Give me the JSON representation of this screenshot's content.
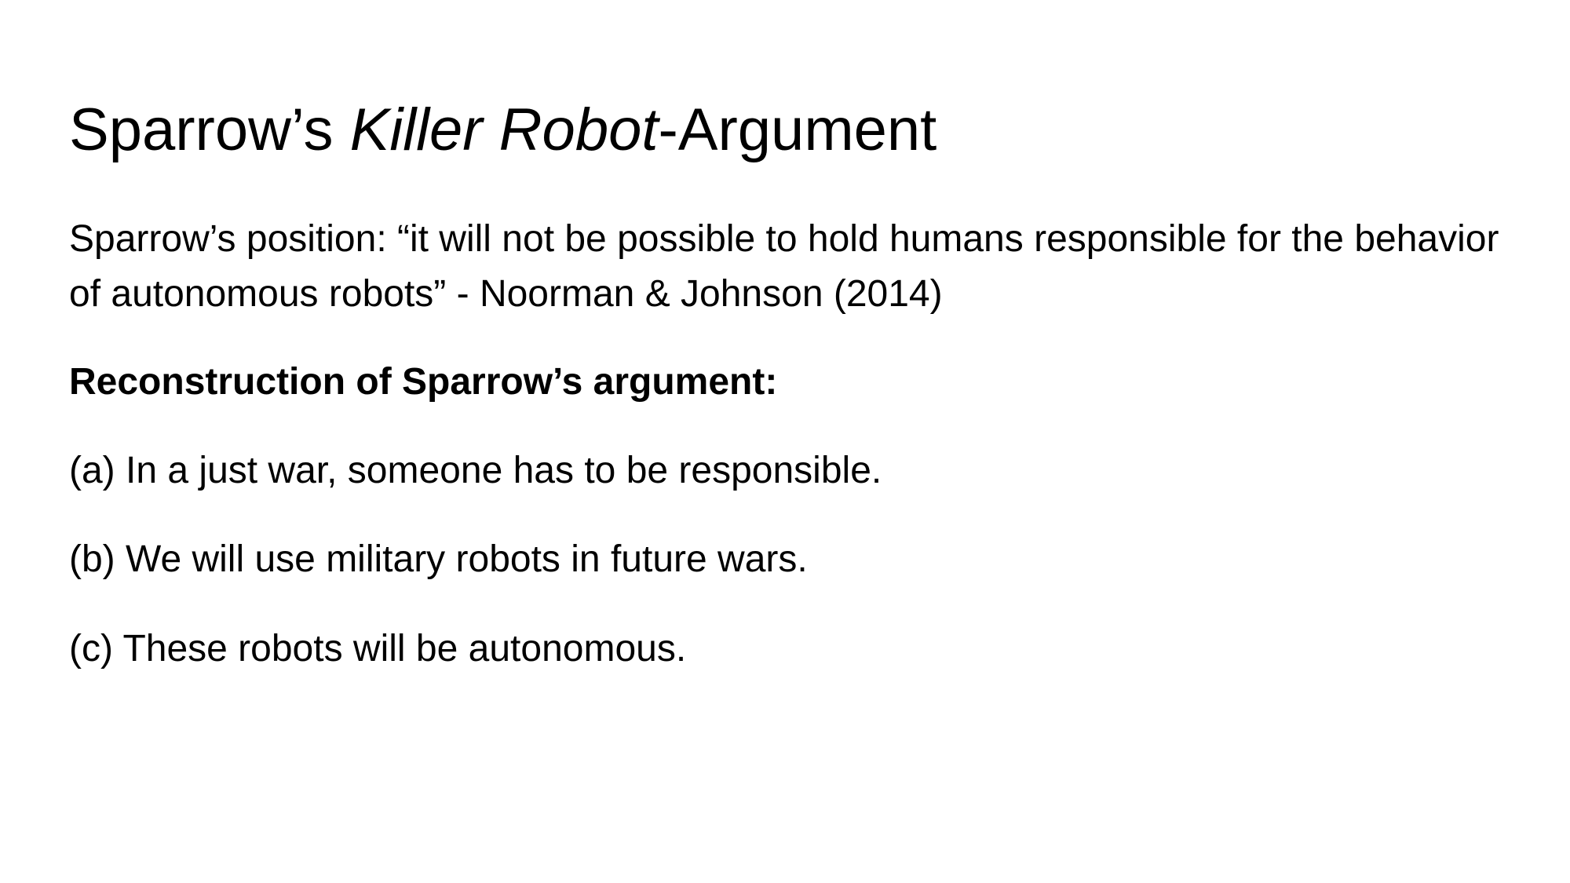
{
  "slide": {
    "title": {
      "part1": "Sparrow’s ",
      "part2_italic": "Killer Robot",
      "part3": "-Argument"
    },
    "position_text": "Sparrow’s position: “it will not be possible to hold humans responsible for the behavior of autonomous robots” - Noorman & Johnson (2014)",
    "reconstruction_heading": "Reconstruction of Sparrow’s argument:",
    "premises": [
      "(a) In a just war, someone has to be responsible.",
      "(b) We will use military robots in future wars.",
      "(c) These robots will be autonomous."
    ]
  }
}
